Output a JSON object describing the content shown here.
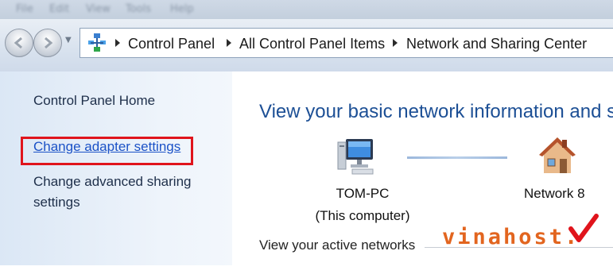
{
  "menubar": {
    "items": [
      "File",
      "Edit",
      "View",
      "Tools",
      "Help"
    ]
  },
  "breadcrumb": {
    "items": [
      "Control Panel",
      "All Control Panel Items",
      "Network and Sharing Center"
    ]
  },
  "sidebar": {
    "home": "Control Panel Home",
    "adapter": "Change adapter settings",
    "sharing_line1": "Change advanced sharing",
    "sharing_line2": "settings"
  },
  "main": {
    "title": "View your basic network information and se",
    "computer_name": "TOM-PC",
    "computer_sub": "(This computer)",
    "network_name": "Network  8",
    "active_networks": "View your active networks"
  },
  "watermark": {
    "text": "vinahost.",
    "color": "#e2651f",
    "check_color": "#e0141c"
  },
  "colors": {
    "highlight": "#e0141c",
    "link": "#1b52c7",
    "title": "#1c4f95"
  }
}
